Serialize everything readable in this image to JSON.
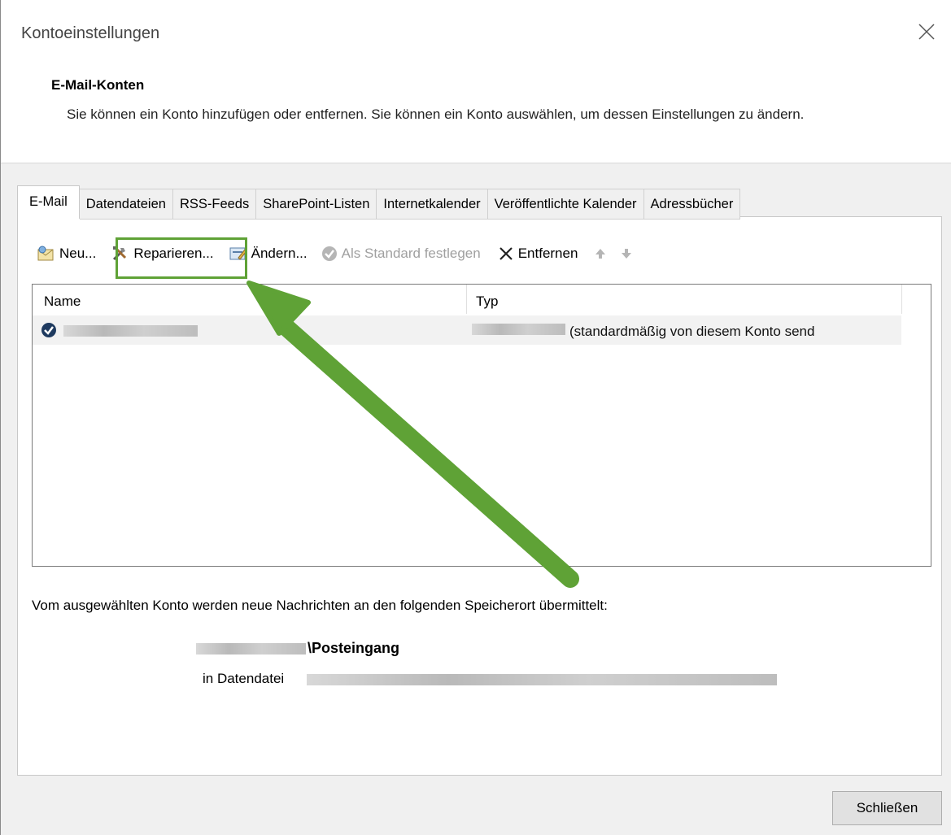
{
  "window": {
    "title": "Kontoeinstellungen"
  },
  "header": {
    "heading": "E-Mail-Konten",
    "description": "Sie können ein Konto hinzufügen oder entfernen. Sie können ein Konto auswählen, um dessen Einstellungen zu ändern."
  },
  "tabs": [
    {
      "label": "E-Mail"
    },
    {
      "label": "Datendateien"
    },
    {
      "label": "RSS-Feeds"
    },
    {
      "label": "SharePoint-Listen"
    },
    {
      "label": "Internetkalender"
    },
    {
      "label": "Veröffentlichte Kalender"
    },
    {
      "label": "Adressbücher"
    }
  ],
  "toolbar": {
    "new_label": "Neu...",
    "repair_label": "Reparieren...",
    "change_label": "Ändern...",
    "default_label": "Als Standard festlegen",
    "remove_label": "Entfernen"
  },
  "list": {
    "col_name": "Name",
    "col_type": "Typ",
    "rows": [
      {
        "type_suffix": "(standardmäßig von diesem Konto send"
      }
    ]
  },
  "delivery": {
    "info": "Vom ausgewählten Konto werden neue Nachrichten an den folgenden Speicherort übermittelt:",
    "folder": "\\Posteingang",
    "datafile_label": "in Datendatei"
  },
  "footer": {
    "close_label": "Schließen"
  },
  "colors": {
    "highlight": "#5fa236",
    "arrow": "#5fa236"
  }
}
